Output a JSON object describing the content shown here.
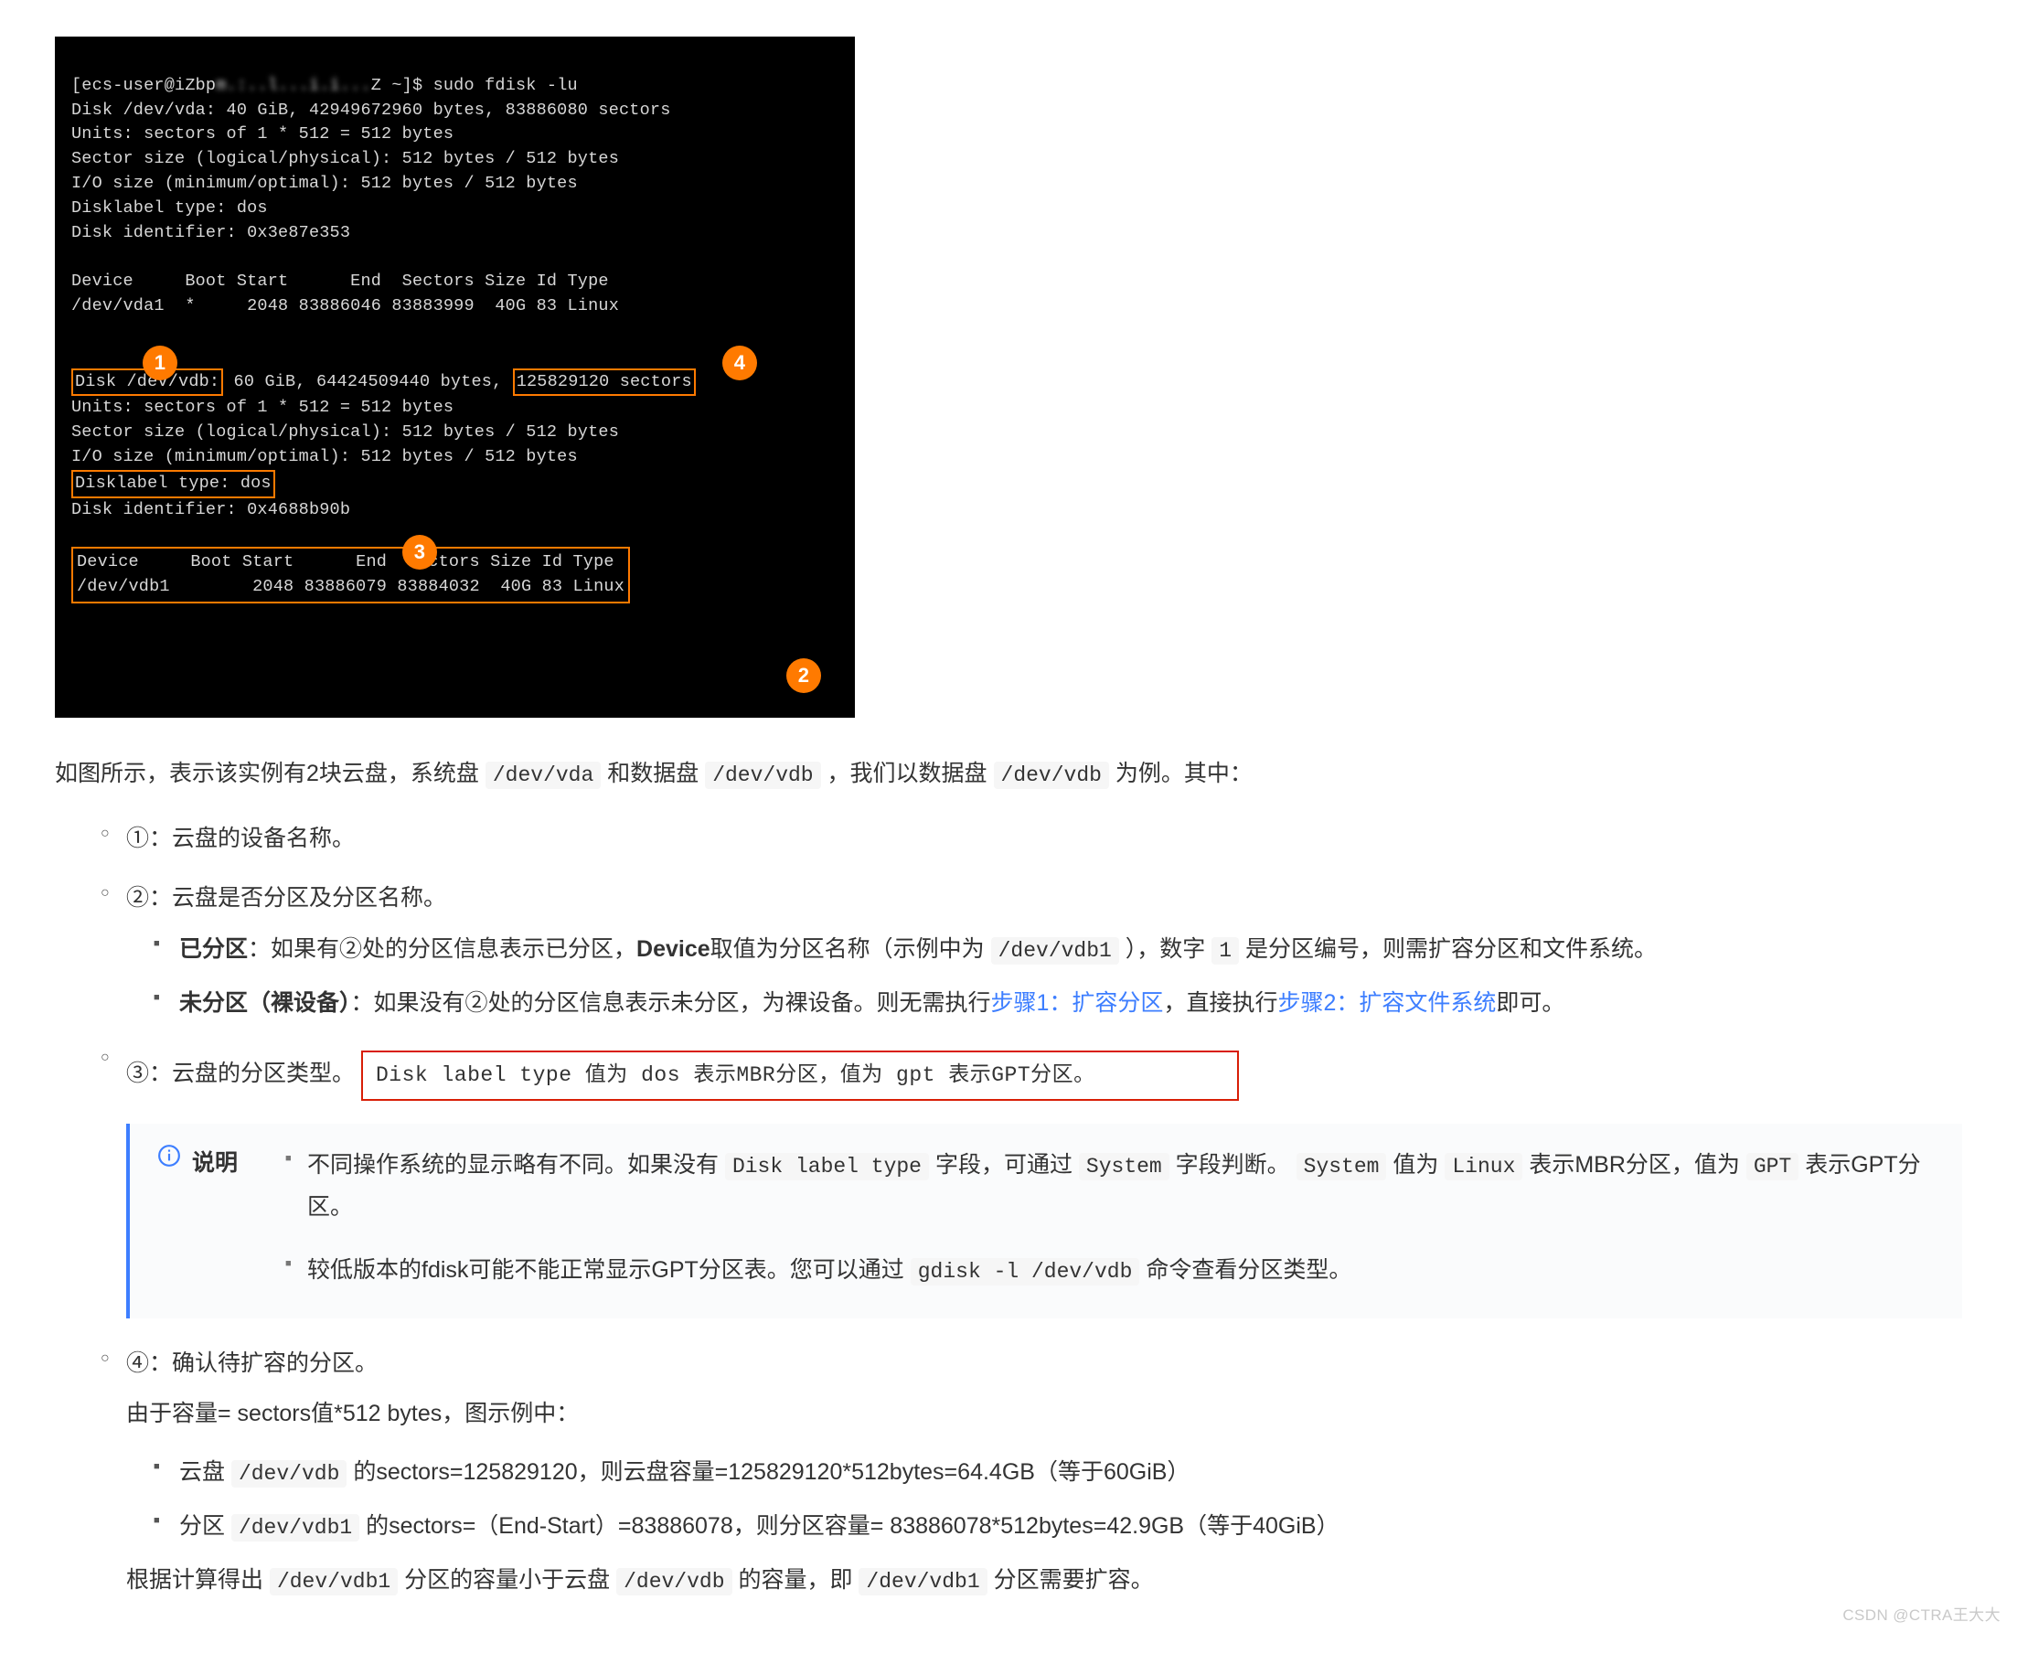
{
  "term": {
    "l1a": "[ecs-user@iZbp",
    "l1b": "m.:..l...i.i...",
    "l1c": "Z ~]$ sudo fdisk -lu",
    "l2": "Disk /dev/vda: 40 GiB, 42949672960 bytes, 83886080 sectors",
    "l3": "Units: sectors of 1 * 512 = 512 bytes",
    "l4": "Sector size (logical/physical): 512 bytes / 512 bytes",
    "l5": "I/O size (minimum/optimal): 512 bytes / 512 bytes",
    "l6": "Disklabel type: dos",
    "l7": "Disk identifier: 0x3e87e353",
    "l8": "Device     Boot Start      End  Sectors Size Id Type",
    "l9": "/dev/vda1  *     2048 83886046 83883999  40G 83 Linux",
    "hi1a": "Disk /dev/vdb:",
    "hi1m": " 60 GiB, 64424509440 bytes, ",
    "hi1b": "125829120 sectors",
    "l11": "Units: sectors of 1 * 512 = 512 bytes",
    "l12": "Sector size (logical/physical): 512 bytes / 512 bytes",
    "l13": "I/O size (minimum/optimal): 512 bytes / 512 bytes",
    "hi3": "Disklabel type: dos",
    "l15": "Disk identifier: 0x4688b90b",
    "hi2a": "Device     Boot Start      End  Sectors Size Id Type",
    "hi2b": "/dev/vdb1        2048 83886079 83884032  40G 83 Linux",
    "m1": "1",
    "m2": "2",
    "m3": "3",
    "m4": "4"
  },
  "intro": {
    "t1": "如图所示，表示该实例有2块云盘，系统盘 ",
    "c1": "/dev/vda",
    "t2": " 和数据盘 ",
    "c2": "/dev/vdb",
    "t3": " ，我们以数据盘 ",
    "c3": "/dev/vdb",
    "t4": " 为例。其中："
  },
  "b1": "①：云盘的设备名称。",
  "b2": "②：云盘是否分区及分区名称。",
  "b2a": {
    "bold": "已分区",
    "t1": "：如果有②处的分区信息表示已分区，",
    "bold2": "Device",
    "t2": "取值为分区名称（示例中为 ",
    "code": "/dev/vdb1",
    "t3": " ），数字 ",
    "code2": "1",
    "t4": " 是分区编号，则需扩容分区和文件系统。"
  },
  "b2b": {
    "bold": "未分区（裸设备）",
    "t1": "：如果没有②处的分区信息表示未分区，为裸设备。则无需执行",
    "link1": "步骤1：扩容分区",
    "t2": "，直接执行",
    "link2": "步骤2：扩容文件系统",
    "t3": "即可。"
  },
  "b3": "③：云盘的分区类型。",
  "redbox": "Disk label type 值为 dos 表示MBR分区，值为 gpt 表示GPT分区。",
  "note": {
    "title": "说明",
    "n1": {
      "t1": "不同操作系统的显示略有不同。如果没有 ",
      "c1": "Disk label type",
      "t2": " 字段，可通过 ",
      "c2": "System",
      "t3": " 字段判断。 ",
      "c3": "System",
      "t4": " 值为 ",
      "c4": "Linux",
      "t5": " 表示MBR分区，值为 ",
      "c5": "GPT",
      "t6": " 表示GPT分区。"
    },
    "n2": {
      "t1": "较低版本的fdisk可能不能正常显示GPT分区表。您可以通过 ",
      "c1": "gdisk -l /dev/vdb",
      "t2": " 命令查看分区类型。"
    }
  },
  "b4": "④：确认待扩容的分区。",
  "b4sub": "由于容量= sectors值*512 bytes，图示例中：",
  "b4a": {
    "t1": "云盘 ",
    "c1": "/dev/vdb",
    "t2": " 的sectors=125829120，则云盘容量=125829120*512bytes=64.4GB（等于60GiB）"
  },
  "b4b": {
    "t1": "分区 ",
    "c1": "/dev/vdb1",
    "t2": " 的sectors=（End-Start）=83886078，则分区容量= 83886078*512bytes=42.9GB（等于40GiB）"
  },
  "b4c": {
    "t1": "根据计算得出 ",
    "c1": "/dev/vdb1",
    "t2": " 分区的容量小于云盘 ",
    "c2": "/dev/vdb",
    "t3": " 的容量，即 ",
    "c3": "/dev/vdb1",
    "t4": " 分区需要扩容。"
  },
  "watermark": "CSDN @CTRA王大大"
}
